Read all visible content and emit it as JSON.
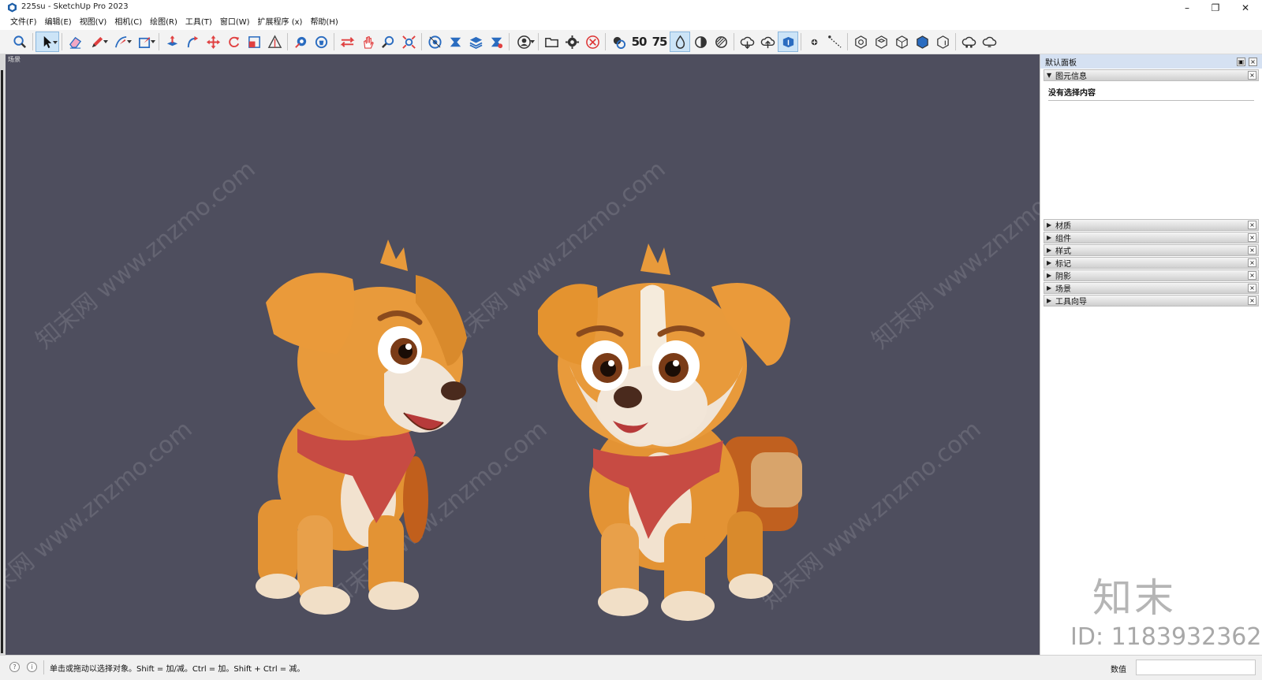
{
  "window": {
    "title": "225su - SketchUp Pro 2023",
    "controls": {
      "minimize": "–",
      "restore": "❐",
      "close": "✕"
    }
  },
  "menu": [
    {
      "label": "文件(F)"
    },
    {
      "label": "编辑(E)"
    },
    {
      "label": "视图(V)"
    },
    {
      "label": "相机(C)"
    },
    {
      "label": "绘图(R)"
    },
    {
      "label": "工具(T)"
    },
    {
      "label": "窗口(W)"
    },
    {
      "label": "扩展程序 (x)"
    },
    {
      "label": "帮助(H)"
    }
  ],
  "toolbar": {
    "tools": [
      {
        "icon": "zoom-icon"
      },
      {
        "icon": "select-icon",
        "active": true,
        "dropdown": true
      },
      {
        "icon": "eraser-icon"
      },
      {
        "icon": "pencil-icon",
        "dropdown": true
      },
      {
        "icon": "arc-icon",
        "dropdown": true
      },
      {
        "icon": "rectangle-icon",
        "dropdown": true
      },
      {
        "icon": "push-pull-icon"
      },
      {
        "icon": "follow-me-icon"
      },
      {
        "icon": "move-icon"
      },
      {
        "icon": "rotate-icon"
      },
      {
        "icon": "scale-icon"
      },
      {
        "icon": "offset-icon"
      },
      {
        "icon": "tape-measure-icon"
      },
      {
        "icon": "paint-bucket-icon"
      },
      {
        "icon": "orbit-icon"
      },
      {
        "icon": "pan-icon"
      },
      {
        "icon": "zoom-magnifier-icon"
      },
      {
        "icon": "zoom-extents-icon"
      },
      {
        "icon": "section-plane-icon"
      },
      {
        "icon": "section-cut-icon"
      },
      {
        "icon": "layers-icon"
      },
      {
        "icon": "section-fill-icon"
      },
      {
        "icon": "user-account-icon",
        "dropdown": true
      },
      {
        "icon": "open-folder-icon"
      },
      {
        "icon": "settings-gear-icon"
      },
      {
        "icon": "close-circle-icon"
      },
      {
        "icon": "style-icon"
      },
      {
        "icon": "number-50-icon",
        "text": "50"
      },
      {
        "icon": "number-75-icon",
        "text": "75"
      },
      {
        "icon": "drop-icon",
        "active": true
      },
      {
        "icon": "half-circle-icon"
      },
      {
        "icon": "hatch-circle-icon"
      },
      {
        "icon": "cloud-download-icon"
      },
      {
        "icon": "cloud-upload-icon"
      },
      {
        "icon": "cloud-sync-icon",
        "active": true
      },
      {
        "icon": "point-icon"
      },
      {
        "icon": "dashed-line-icon"
      },
      {
        "icon": "view-iso-icon"
      },
      {
        "icon": "view-top-icon"
      },
      {
        "icon": "view-front-icon"
      },
      {
        "icon": "view-right-icon"
      },
      {
        "icon": "view-back-icon"
      },
      {
        "icon": "cloud-share-icon"
      },
      {
        "icon": "cloud-refresh-icon"
      }
    ]
  },
  "viewport": {
    "scene_label": "场景",
    "background": "#4e4e5e",
    "watermark": "知末网 www.znzmo.com"
  },
  "tray": {
    "title": "默认面板",
    "entity_info": {
      "label": "图元信息",
      "empty_text": "没有选择内容"
    },
    "panels": [
      {
        "label": "材质"
      },
      {
        "label": "组件"
      },
      {
        "label": "样式"
      },
      {
        "label": "标记"
      },
      {
        "label": "阴影"
      },
      {
        "label": "场景"
      },
      {
        "label": "工具向导"
      }
    ],
    "watermark_logo": "知末",
    "watermark_id": "ID: 1183932362"
  },
  "status": {
    "hint": "单击或拖动以选择对象。Shift = 加/减。Ctrl = 加。Shift + Ctrl = 减。",
    "measurements_label": "数值",
    "measurements_value": ""
  },
  "colors": {
    "viewport_bg": "#4e4e5e",
    "dog_fur": "#e8952e",
    "scarf": "#c8473f",
    "active_tool": "#cce4f7"
  }
}
